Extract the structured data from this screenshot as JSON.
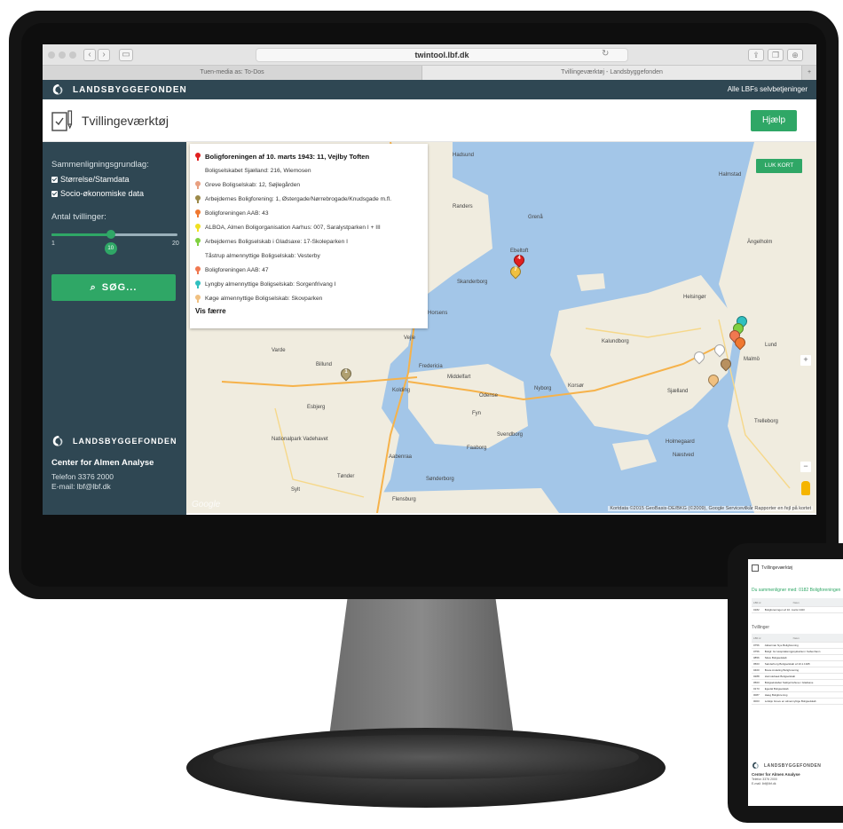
{
  "browser": {
    "url": "twintool.lbf.dk",
    "tabs": [
      "Tuen-media as: To-Dos",
      "Tvillingeværktøj - Landsbyggefonden"
    ]
  },
  "topnav": {
    "brand": "LANDSBYGGEFONDEN",
    "link": "Alle LBFs selvbetjeninger"
  },
  "header": {
    "title": "Tvillingeværktøj",
    "help_label": "Hjælp"
  },
  "sidebar": {
    "basis_label": "Sammenligningsgrundlag:",
    "check_size": "Størrelse/Stamdata",
    "check_socio": "Socio-økonomiske data",
    "twins_label": "Antal tvillinger:",
    "slider_min": "1",
    "slider_max": "20",
    "slider_value": "10",
    "slider_fraction": 0.47,
    "search_label": "SØG...",
    "footer_brand": "LANDSBYGGEFONDEN",
    "center": "Center for Almen Analyse",
    "phone": "Telefon 3376 2000",
    "email": "E-mail: lbf@lbf.dk"
  },
  "map": {
    "close_label": "LUK KORT",
    "attribution": "Kortdata ©2015 GeoBasis-DE/BKG (©2009), Google   Servicevilkår   Rapporter en fejl på kortet",
    "google": "Google",
    "legend": [
      {
        "text": "Boligforeningen af 10. marts 1943: 11, Vejlby Toften",
        "color": "#e02020",
        "main": true
      },
      {
        "text": "Boligselskabet Sjælland: 216, Wiemosen",
        "color": "#ffffff"
      },
      {
        "text": "Greve Boligselskab: 12, Søjlegården",
        "color": "#e8a080"
      },
      {
        "text": "Arbejdernes Boligforening: 1, Østergade/Nørrebrogade/Knudsgade m.fl.",
        "color": "#9c8a4a"
      },
      {
        "text": "Boligforeningen AAB: 43",
        "color": "#f07830"
      },
      {
        "text": "ALBOA, Almen Boligorganisation Aarhus: 007, Saralystparken I + III",
        "color": "#f0e020"
      },
      {
        "text": "Arbejdernes Boligselskab i Gladsaxe: 17-Skoleparken I",
        "color": "#80d040"
      },
      {
        "text": "Tåstrup almennyttige Boligselskab: Vesterby",
        "color": "#ffffff"
      },
      {
        "text": "Boligforeningen AAB: 47",
        "color": "#f07850"
      },
      {
        "text": "Lyngby almennyttige Boligselskab: Sorgenfrivang I",
        "color": "#30c0c0"
      },
      {
        "text": "Køge almennyttige Boligselskab: Skovparken",
        "color": "#f0c080"
      }
    ],
    "show_less": "Vis færre",
    "places": [
      "Hadsund",
      "Randers",
      "Grenå",
      "Ebeltoft",
      "Skanderborg",
      "Horsens",
      "Vejle",
      "Varde",
      "Billund",
      "Esbjerg",
      "Fredericia",
      "Kolding",
      "Middelfart",
      "Odense",
      "Nyborg",
      "Korsør",
      "Kalundborg",
      "Fyn",
      "Svendborg",
      "Faaborg",
      "Aabenraa",
      "Sønderborg",
      "Flensburg",
      "Tønder",
      "Sylt",
      "Helsingør",
      "Halmstad",
      "Ängelholm",
      "Lund",
      "Malmö",
      "Trelleborg",
      "Næstved",
      "Sjælland",
      "Nationalpark Vadehavet",
      "Holmegaard"
    ]
  },
  "tablet": {
    "title": "Tvillingeværktøj",
    "compare": "Du sammenligner med: 0182 Boligforeningen",
    "section": "Tvillinger",
    "head": [
      "LBF.nr",
      "Navn"
    ],
    "selected": [
      "0182",
      "Boligforeningen af 10. marts 1943"
    ],
    "rows": [
      [
        "0756",
        "Akkerman Nye Boligforening"
      ],
      [
        "0756",
        "Boligf. for Hospitalsmigpsykiatrien i København"
      ],
      [
        "0856",
        "Skive Boligselskab"
      ],
      [
        "0563",
        "Sønderborg Boligselskab af 10.1.1945"
      ],
      [
        "0400",
        "Boste Andeling Boligforening"
      ],
      [
        "0288",
        "Hornslebaek Boligselskab"
      ],
      [
        "0563",
        "Boligselskabet Sæbjørnshuse i Gladsaxe"
      ],
      [
        "0173",
        "Egedal Boligselskab"
      ],
      [
        "0087",
        "Høeg Boligforening"
      ],
      [
        "0003",
        "Lolskjo Greve en almennyttige Boligselskab"
      ]
    ],
    "brand": "LANDSBYGGEFONDEN",
    "center": "Center for Almen Analyse",
    "phone": "Telefon 3376 2000",
    "email": "E-mail: lbf@lbf.dk"
  }
}
